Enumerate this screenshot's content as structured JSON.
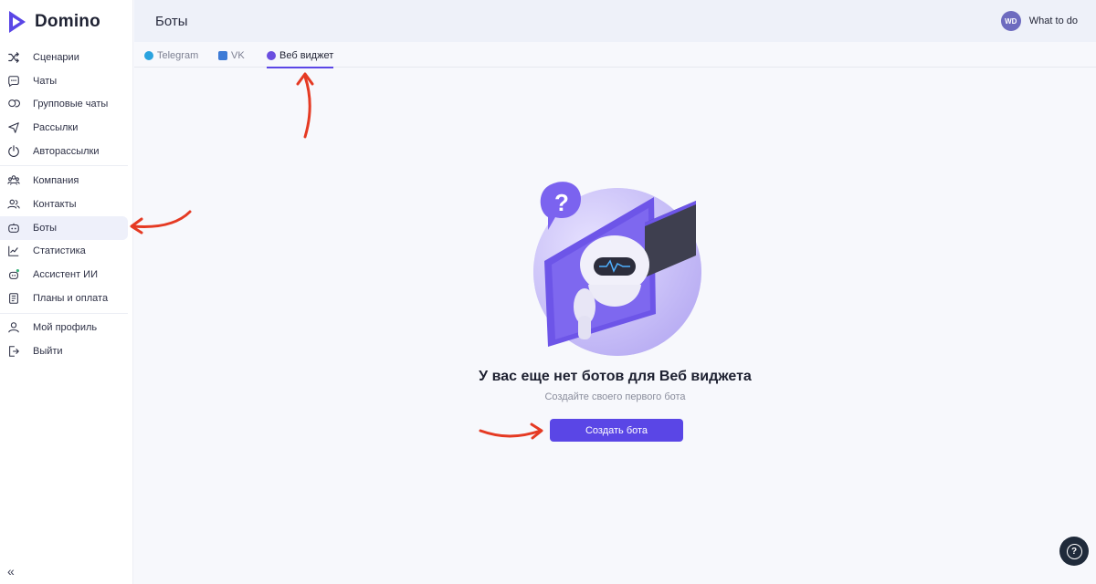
{
  "app": {
    "name": "Domino"
  },
  "sidebar": {
    "groups": [
      [
        {
          "label": "Сценарии",
          "icon": "shuffle-icon"
        },
        {
          "label": "Чаты",
          "icon": "chat-icon"
        },
        {
          "label": "Групповые чаты",
          "icon": "group-chat-icon"
        },
        {
          "label": "Рассылки",
          "icon": "send-icon"
        },
        {
          "label": "Авторассылки",
          "icon": "power-icon"
        }
      ],
      [
        {
          "label": "Компания",
          "icon": "company-icon"
        },
        {
          "label": "Контакты",
          "icon": "contacts-icon"
        },
        {
          "label": "Боты",
          "icon": "bot-icon",
          "active": true
        },
        {
          "label": "Статистика",
          "icon": "chart-icon"
        },
        {
          "label": "Ассистент ИИ",
          "icon": "ai-assistant-icon"
        },
        {
          "label": "Планы и оплата",
          "icon": "billing-icon"
        }
      ],
      [
        {
          "label": "Мой профиль",
          "icon": "profile-icon"
        },
        {
          "label": "Выйти",
          "icon": "logout-icon"
        }
      ]
    ],
    "collapse_glyph": "«"
  },
  "header": {
    "title": "Боты",
    "user": {
      "initials": "WD",
      "name": "What to do"
    }
  },
  "tabs": [
    {
      "label": "Telegram",
      "icon": "telegram-icon",
      "color": "#2aa3df"
    },
    {
      "label": "VK",
      "icon": "vk-icon",
      "color": "#3d7bd6"
    },
    {
      "label": "Веб виджет",
      "icon": "web-widget-icon",
      "color": "#6b4fe0",
      "active": true
    }
  ],
  "empty_state": {
    "title": "У вас еще нет ботов для Веб виджета",
    "subtitle": "Создайте своего первого бота",
    "button_label": "Создать бота"
  },
  "help": {
    "glyph": "?"
  },
  "colors": {
    "accent": "#5a46e6",
    "annotation": "#e53a23",
    "header_bg": "#eef1f9"
  }
}
